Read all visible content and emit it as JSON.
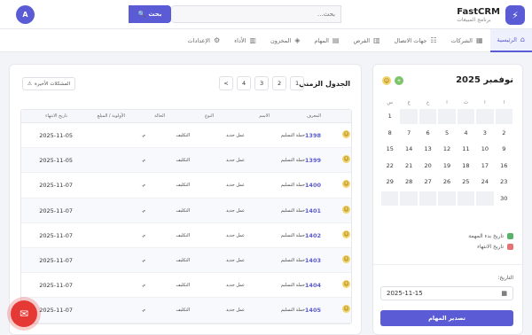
{
  "brand": {
    "name": "FastCRM",
    "subtitle": "برنامج المبيعات"
  },
  "search": {
    "placeholder": "بحث...",
    "button": "بحث"
  },
  "user": {
    "initial": "A"
  },
  "nav": [
    {
      "label": "الرئيسية",
      "icon": "home-icon",
      "glyph": "⌂",
      "active": true
    },
    {
      "label": "الشركات",
      "icon": "building-icon",
      "glyph": "▦"
    },
    {
      "label": "جهات الاتصال",
      "icon": "contacts-icon",
      "glyph": "☷"
    },
    {
      "label": "الفرص",
      "icon": "chart-icon",
      "glyph": "▥"
    },
    {
      "label": "المهام",
      "icon": "clipboard-icon",
      "glyph": "▤"
    },
    {
      "label": "المخزون",
      "icon": "box-icon",
      "glyph": "◈"
    },
    {
      "label": "الأداء",
      "icon": "bar-chart-icon",
      "glyph": "▥"
    },
    {
      "label": "الإعدادات",
      "icon": "gear-icon",
      "glyph": "⚙"
    }
  ],
  "calendar": {
    "month_title": "نوفمبر 2025",
    "dow": [
      "ا",
      "ا",
      "ث",
      "ا",
      "خ",
      "ج",
      "س"
    ],
    "rows": [
      [
        "",
        "",
        "",
        "",
        "",
        "",
        "1"
      ],
      [
        "2",
        "3",
        "4",
        "5",
        "6",
        "7",
        "8"
      ],
      [
        "9",
        "10",
        "11",
        "12",
        "13",
        "14",
        "15"
      ],
      [
        "16",
        "17",
        "18",
        "19",
        "20",
        "21",
        "22"
      ],
      [
        "23",
        "24",
        "25",
        "26",
        "27",
        "28",
        "29"
      ],
      [
        "30",
        "",
        "",
        "",
        "",
        "",
        ""
      ]
    ],
    "legend": [
      {
        "label": "تاريخ بدء المهمة",
        "color": "#58b368"
      },
      {
        "label": "تاريخ الانتهاء",
        "color": "#e57373"
      }
    ],
    "date_label": "التاريخ:",
    "date_value": "2025-11-15",
    "export_button": "تصدير المهام"
  },
  "timeline": {
    "title": "الجدول الزمني",
    "issues_button": "المشكلات الأخيرة",
    "pages": [
      "1",
      "2",
      "3",
      "4",
      ">"
    ],
    "columns": [
      "المعرف",
      "الاسم",
      "النوع",
      "الحالة",
      "الأولوية / المبلغ",
      "تاريخ الانتهاء"
    ],
    "rows": [
      {
        "id": "1398",
        "name": "حملة التسليم",
        "type": "عمل جديد",
        "status": "التكليف",
        "priority": "م.",
        "due": "2025-11-05"
      },
      {
        "id": "1399",
        "name": "حملة التسليم",
        "type": "عمل جديد",
        "status": "التكليف",
        "priority": "م.",
        "due": "2025-11-05"
      },
      {
        "id": "1400",
        "name": "حملة التسليم",
        "type": "عمل جديد",
        "status": "التكليف",
        "priority": "م.",
        "due": "2025-11-07"
      },
      {
        "id": "1401",
        "name": "حملة التسليم",
        "type": "عمل جديد",
        "status": "التكليف",
        "priority": "م.",
        "due": "2025-11-07"
      },
      {
        "id": "1402",
        "name": "حملة التسليم",
        "type": "عمل جديد",
        "status": "التكليف",
        "priority": "م.",
        "due": "2025-11-07"
      },
      {
        "id": "1403",
        "name": "حملة التسليم",
        "type": "عمل جديد",
        "status": "التكليف",
        "priority": "م.",
        "due": "2025-11-07"
      },
      {
        "id": "1404",
        "name": "حملة التسليم",
        "type": "عمل جديد",
        "status": "التكليف",
        "priority": "م.",
        "due": "2025-11-07"
      },
      {
        "id": "1405",
        "name": "حملة التسليم",
        "type": "عمل جديد",
        "status": "التكليف",
        "priority": "م.",
        "due": "2025-11-07"
      }
    ]
  },
  "colors": {
    "accent": "#5b5bd6",
    "fab": "#e53935"
  }
}
